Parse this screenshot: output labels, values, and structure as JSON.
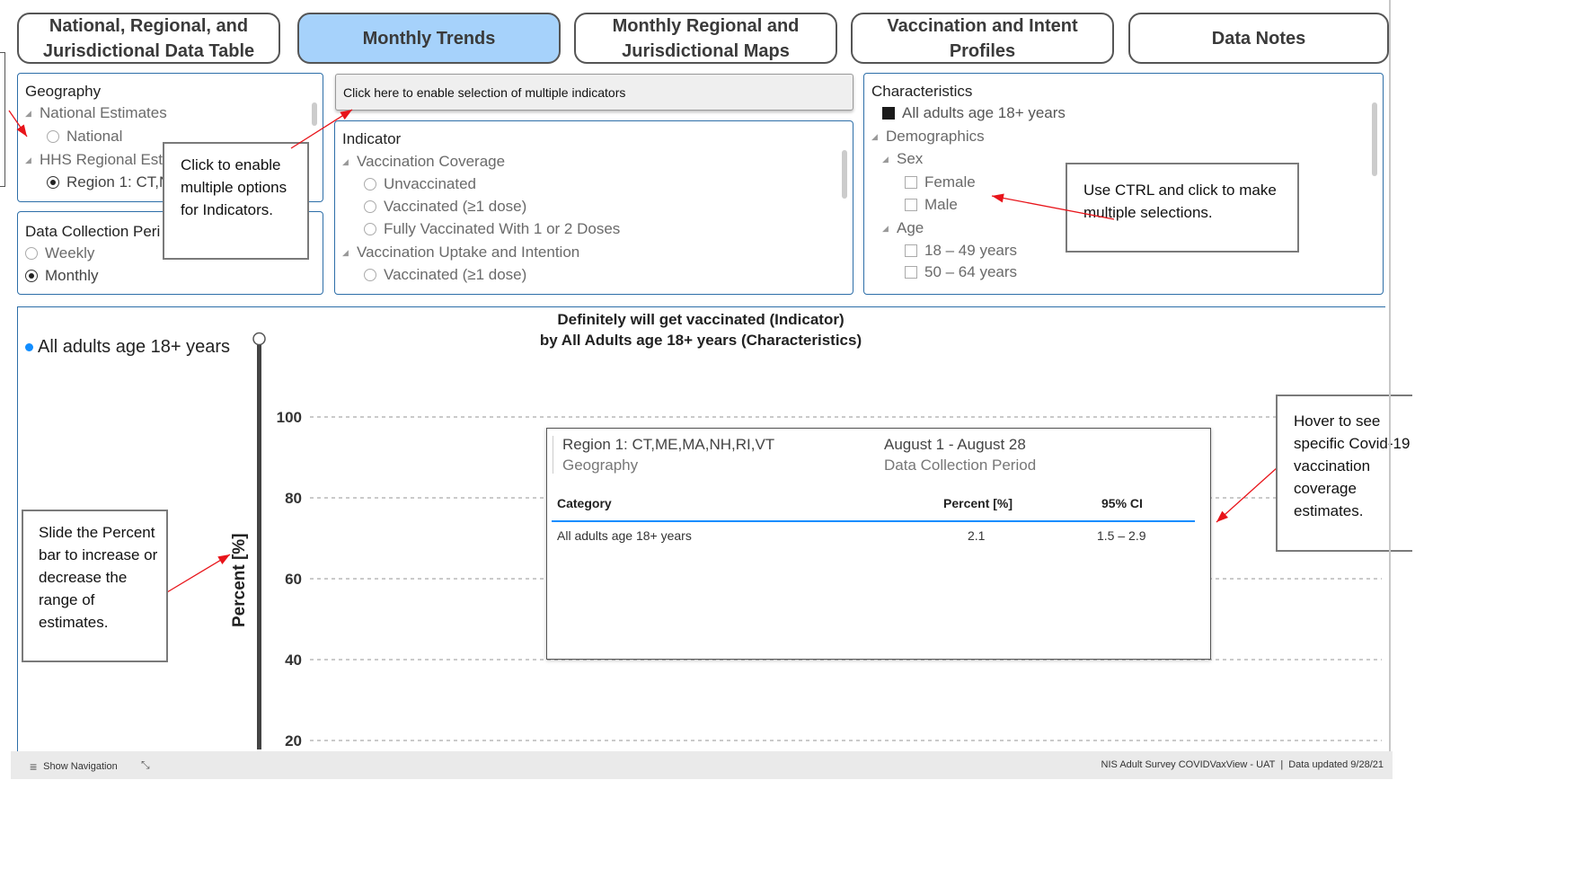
{
  "tabs": [
    {
      "label": "National, Regional, and Jurisdictional Data Table",
      "active": false
    },
    {
      "label": "Monthly Trends",
      "active": true
    },
    {
      "label": "Monthly Regional and Jurisdictional Maps",
      "active": false
    },
    {
      "label": "Vaccination and Intent Profiles",
      "active": false
    },
    {
      "label": "Data Notes",
      "active": false
    }
  ],
  "geography": {
    "title": "Geography",
    "national_group": "National Estimates",
    "national": "National",
    "hhs_group": "HHS Regional Esti",
    "region_selected": "Region 1: CT,N"
  },
  "period": {
    "title": "Data Collection Peri",
    "options": [
      "Weekly",
      "Monthly"
    ],
    "selected": "Monthly"
  },
  "enable_button": "Click here to enable selection of multiple indicators",
  "indicator": {
    "title": "Indicator",
    "group1": "Vaccination Coverage",
    "opt1": "Unvaccinated",
    "opt2": "Vaccinated (≥1 dose)",
    "opt3": "Fully Vaccinated With 1 or 2 Doses",
    "group2": "Vaccination Uptake and Intention",
    "opt4": "Vaccinated (≥1 dose)"
  },
  "characteristics": {
    "title": "Characteristics",
    "all_adults": "All adults age 18+ years",
    "demographics": "Demographics",
    "sex": "Sex",
    "female": "Female",
    "male": "Male",
    "age": "Age",
    "age1": "18 – 49 years",
    "age2": "50 – 64 years"
  },
  "callouts": {
    "multi_indicators": "Click to enable multiple options for Indicators.",
    "ctrl": "Use CTRL and click to make multiple selections.",
    "slide": "Slide the Percent bar to increase or decrease the range of estimates.",
    "hover": "Hover to see specific Covid-19 vaccination coverage estimates."
  },
  "chart_data": {
    "type": "line",
    "title": "Definitely will get vaccinated (Indicator)",
    "subtitle": "by All Adults age 18+ years (Characteristics)",
    "ylabel": "Percent [%]",
    "yticks": [
      100,
      80,
      60,
      40,
      20
    ],
    "ylim": [
      20,
      100
    ],
    "grid": true,
    "legend": "All adults age 18+ years",
    "legend_color": "#118dff"
  },
  "tooltip": {
    "geography_value": "Region 1: CT,ME,MA,NH,RI,VT",
    "geography_label": "Geography",
    "period_value": "August 1 - August 28",
    "period_label": "Data Collection Period",
    "col_category": "Category",
    "col_percent": "Percent [%]",
    "col_ci": "95% CI",
    "row_category": "All adults age 18+ years",
    "row_percent": "2.1",
    "row_ci": "1.5 – 2.9"
  },
  "status": {
    "show_navigation": "Show Navigation",
    "right": "NIS Adult Survey COVIDVaxView - UAT",
    "updated": "Data updated 9/28/21"
  },
  "colors": {
    "accent": "#2d6ea8",
    "active_tab": "#a6d2fb",
    "arrow": "#e8141a"
  }
}
